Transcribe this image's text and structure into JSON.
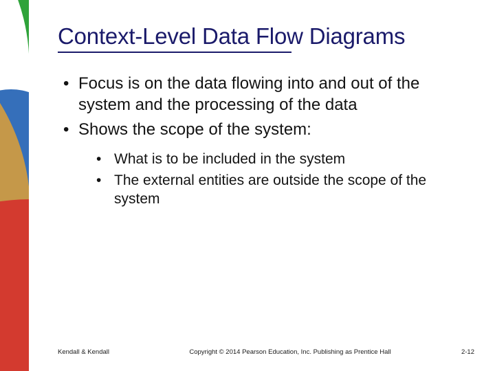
{
  "colors": {
    "heading": "#1a1a6a",
    "text": "#131313",
    "decoGreen": "#2fa33a",
    "decoBlue": "#1f5fb2",
    "decoOrange": "#f5a623",
    "decoRed": "#d33a2f"
  },
  "heading": {
    "title": "Context-Level Data Flow Diagrams"
  },
  "bullets": [
    {
      "text": "Focus is on the data flowing into and out of the system and the processing of the data"
    },
    {
      "text": "Shows the scope of the system:",
      "children": [
        {
          "text": "What is to be included in the system"
        },
        {
          "text": "The external entities are outside the scope of the system"
        }
      ]
    }
  ],
  "footer": {
    "left": "Kendall & Kendall",
    "center": "Copyright © 2014 Pearson Education, Inc. Publishing as Prentice Hall",
    "right": "2-12"
  }
}
